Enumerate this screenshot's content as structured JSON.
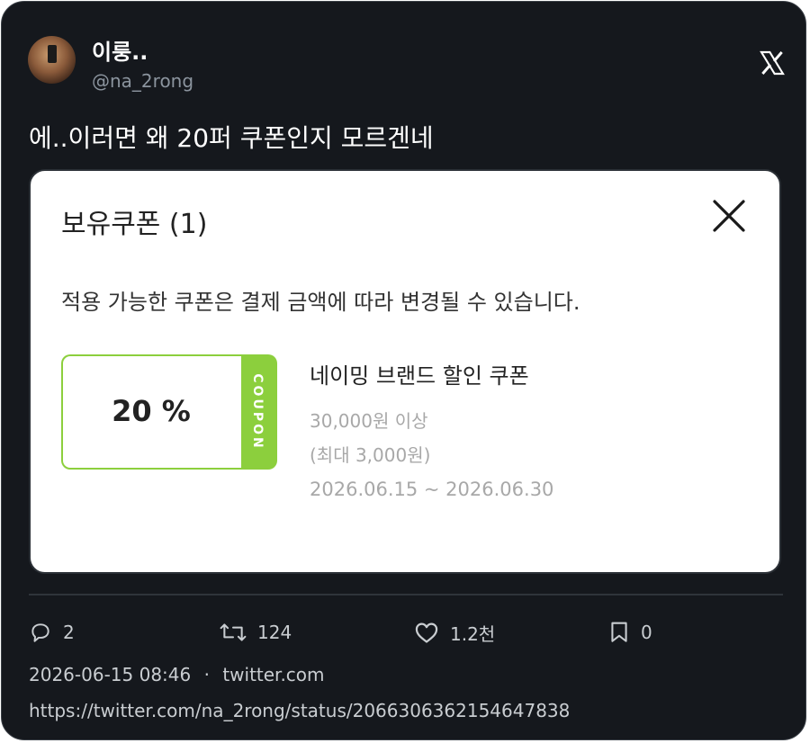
{
  "tweet": {
    "display_name": "이룽..",
    "handle": "@na_2rong",
    "text": "에..이러면 왜 20퍼 쿠폰인지 모르겐네",
    "platform_icon": "x-logo-icon"
  },
  "media": {
    "title": "보유쿠폰 (1)",
    "notice": "적용 가능한 쿠폰은 결제 금액에 따라 변경될 수 있습니다.",
    "coupon": {
      "percent": "20 %",
      "stub_label": "COUPON",
      "name": "네이밍 브랜드 할인 쿠폰",
      "min_amount": "30,000원 이상",
      "max_discount": "(최대 3,000원)",
      "period": "2026.06.15 ~ 2026.06.30",
      "accent_color": "#8ccf3d"
    }
  },
  "actions": {
    "replies": "2",
    "retweets": "124",
    "likes": "1.2천",
    "bookmarks": "0"
  },
  "meta": {
    "timestamp": "2026-06-15 08:46",
    "separator": "·",
    "source": "twitter.com",
    "url": "https://twitter.com/na_2rong/status/2066306362154647838"
  }
}
